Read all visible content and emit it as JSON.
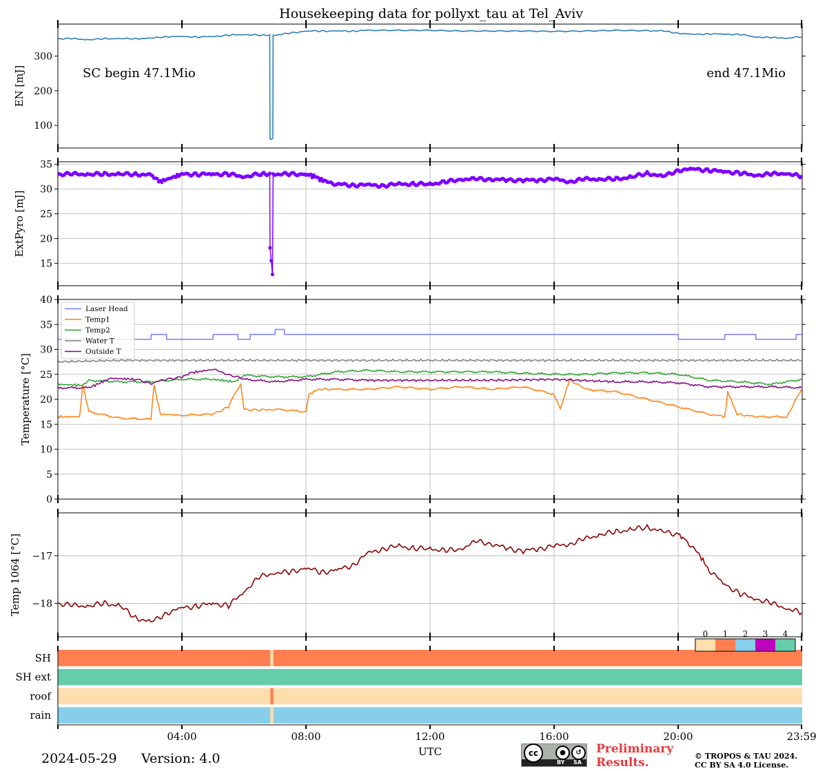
{
  "title": "Housekeeping data for pollyxt_tau at Tel_Aviv",
  "footer": {
    "date": "2024-05-29",
    "version": "Version: 4.0",
    "preliminary": [
      "Preliminary",
      "Results."
    ],
    "copyright": [
      "© TROPOS & TAU 2024.",
      "CC BY SA 4.0 License."
    ],
    "license_badge": {
      "main": "cc",
      "by": "BY",
      "sa": "SA"
    }
  },
  "chart_data": [
    {
      "type": "line",
      "ylabel": "EN [mJ]",
      "xlim": [
        0,
        24
      ],
      "ylim": [
        35,
        392
      ],
      "yticks": [
        100,
        200,
        300
      ],
      "grid": false,
      "annotations": [
        "SC begin 47.1Mio",
        "end 47.1Mio"
      ],
      "series": [
        {
          "color": "#1f77b4",
          "x": [
            0,
            0.5,
            1,
            1.5,
            2,
            2.5,
            3,
            3.5,
            4,
            4.5,
            5,
            5.5,
            6,
            6.5,
            6.83,
            6.84,
            6.85,
            6.93,
            6.94,
            7.0,
            7.5,
            8,
            8.5,
            9,
            9.5,
            10,
            11,
            12,
            13,
            14,
            15,
            16,
            17,
            18,
            19,
            19.5,
            20,
            20.5,
            21,
            21.5,
            22,
            22.5,
            23,
            23.5,
            23.98
          ],
          "y": [
            350,
            350,
            347,
            350,
            350,
            350,
            351,
            356,
            356,
            355,
            356,
            360,
            362,
            360,
            360,
            61,
            61,
            61,
            360,
            360,
            366,
            372,
            372,
            372,
            372,
            374,
            374,
            374,
            372,
            372,
            372,
            371,
            372,
            374,
            373,
            372,
            366,
            362,
            364,
            363,
            362,
            355,
            353,
            352,
            355
          ]
        }
      ]
    },
    {
      "type": "line",
      "ylabel": "ExtPyro [mJ]",
      "xlim": [
        0,
        24
      ],
      "ylim": [
        10.5,
        35.5
      ],
      "yticks": [
        15,
        20,
        25,
        30,
        35
      ],
      "grid": true,
      "series": [
        {
          "color": "#7f00ff",
          "markers": true,
          "x": [
            0,
            0.5,
            1,
            1.5,
            2,
            2.5,
            3,
            3.3,
            4,
            4.5,
            5,
            5.5,
            6,
            6.5,
            6.83,
            6.84,
            6.88,
            6.92,
            6.94,
            7.0,
            7.5,
            8,
            8.3,
            8.6,
            9,
            9.5,
            10,
            10.5,
            11,
            11.5,
            12,
            12.5,
            13,
            13.5,
            14,
            14.5,
            15,
            15.5,
            16,
            16.5,
            17,
            17.5,
            18,
            18.5,
            19,
            19.5,
            20,
            20.5,
            21,
            21.5,
            22,
            22.5,
            23,
            23.5,
            23.98
          ],
          "y": [
            33.0,
            33.0,
            33.0,
            33.0,
            33.0,
            33.0,
            32.8,
            31.5,
            33.0,
            33.0,
            33.0,
            33.0,
            32.5,
            33.0,
            33.0,
            18.0,
            15.5,
            12.5,
            33.0,
            33.0,
            33.0,
            33.0,
            32.5,
            31.5,
            31.0,
            30.8,
            30.8,
            30.7,
            31.0,
            31.0,
            31.0,
            31.4,
            32.0,
            32.0,
            32.0,
            31.8,
            31.8,
            31.8,
            32.0,
            31.5,
            32.0,
            32.0,
            32.0,
            32.4,
            33.2,
            32.5,
            33.8,
            34.0,
            33.8,
            33.5,
            33.2,
            32.8,
            33.0,
            33.2,
            32.5
          ]
        }
      ]
    },
    {
      "type": "line",
      "ylabel": "Temperature [$^\\circ C$]",
      "xlim": [
        0,
        24
      ],
      "ylim": [
        0,
        40
      ],
      "yticks": [
        0,
        5,
        10,
        15,
        20,
        25,
        30,
        35,
        40
      ],
      "grid": true,
      "legend": "top-left",
      "series": [
        {
          "name": "Laser Head",
          "color": "#7a7aff",
          "x": [
            0,
            3,
            3.01,
            3.5,
            3.51,
            5,
            5.01,
            5.8,
            5.81,
            6.2,
            6.21,
            7.0,
            7.01,
            7.3,
            7.31,
            8.0,
            8.01,
            20.0,
            20.01,
            21.5,
            21.51,
            22.5,
            22.51,
            23.8,
            23.81,
            23.98
          ],
          "y": [
            32,
            32,
            33,
            33,
            32,
            32,
            33,
            33,
            32,
            32,
            33,
            33,
            34,
            34,
            33,
            33,
            33,
            33,
            32,
            32,
            33,
            33,
            32,
            32,
            33,
            33
          ]
        },
        {
          "name": "Temp1",
          "color": "#ff7f0e",
          "x": [
            0,
            0.7,
            0.8,
            1.0,
            2.0,
            3.0,
            3.1,
            3.3,
            4.0,
            5.0,
            5.5,
            5.6,
            5.9,
            6.0,
            6.5,
            7.0,
            8.0,
            8.1,
            8.4,
            9.0,
            10.0,
            11.0,
            12.0,
            13.0,
            14.0,
            15.0,
            16.0,
            16.2,
            16.5,
            17.0,
            18.0,
            19.0,
            20.0,
            21.0,
            21.5,
            21.6,
            21.9,
            22.5,
            23.5,
            23.98
          ],
          "y": [
            16.5,
            16.5,
            23.0,
            17.5,
            16.2,
            16.0,
            23.0,
            17.0,
            16.8,
            17.0,
            18.5,
            20.0,
            23.0,
            18.0,
            17.8,
            18.0,
            17.5,
            21.0,
            22.0,
            22.0,
            22.0,
            22.5,
            22.0,
            22.5,
            22.0,
            22.5,
            21.0,
            18.0,
            24.0,
            22.0,
            21.5,
            20.0,
            18.5,
            17.0,
            16.5,
            21.5,
            17.0,
            16.5,
            16.5,
            22.0
          ]
        },
        {
          "name": "Temp2",
          "color": "#2ca02c",
          "x": [
            0,
            0.8,
            1.0,
            2.0,
            3.0,
            4.0,
            5.0,
            5.7,
            6.0,
            7.0,
            8.0,
            9.0,
            10.0,
            11.0,
            12.0,
            13.0,
            14.0,
            15.0,
            16.0,
            17.0,
            18.0,
            19.0,
            20.0,
            21.0,
            22.0,
            23.0,
            23.98
          ],
          "y": [
            23.0,
            22.8,
            23.8,
            23.5,
            23.5,
            24.0,
            24.0,
            23.5,
            24.8,
            24.5,
            24.5,
            25.5,
            25.8,
            25.5,
            25.5,
            25.5,
            25.5,
            25.2,
            25.0,
            25.0,
            25.3,
            25.3,
            25.0,
            23.8,
            23.5,
            23.0,
            24.0
          ]
        },
        {
          "name": "Water T",
          "color": "#7f7f7f",
          "x": [
            0,
            2,
            4,
            6,
            8,
            10,
            12,
            14,
            16,
            18,
            20,
            22,
            23.98
          ],
          "y": [
            27.5,
            27.8,
            27.8,
            27.8,
            27.8,
            27.8,
            27.8,
            27.8,
            27.8,
            27.8,
            27.8,
            27.8,
            27.8
          ]
        },
        {
          "name": "Outside T",
          "color": "#800080",
          "x": [
            0,
            1.0,
            1.7,
            2.5,
            3.0,
            3.5,
            4.0,
            4.3,
            5.0,
            5.5,
            6.0,
            7.0,
            8.0,
            9.0,
            10.0,
            12.0,
            14.0,
            16.0,
            18.0,
            19.0,
            20.0,
            21.0,
            22.0,
            23.0,
            23.98
          ],
          "y": [
            22.3,
            22.3,
            24.2,
            24.0,
            23.2,
            24.0,
            24.5,
            25.3,
            26.0,
            25.0,
            24.0,
            23.5,
            24.0,
            24.0,
            23.8,
            23.8,
            23.8,
            24.0,
            23.5,
            23.5,
            23.3,
            22.5,
            22.5,
            22.5,
            22.3
          ]
        }
      ]
    },
    {
      "type": "line",
      "ylabel": "Temp 1064 [$^\\circ C$]",
      "xlim": [
        0,
        24
      ],
      "ylim": [
        -18.7,
        -16.1
      ],
      "yticks": [
        -18,
        -17
      ],
      "grid": true,
      "series": [
        {
          "color": "#8b0000",
          "x": [
            0,
            0.5,
            1,
            1.5,
            2,
            2.5,
            3,
            3.5,
            4,
            4.5,
            5,
            5.5,
            6,
            6.5,
            7,
            7.5,
            8,
            8.5,
            9,
            9.5,
            10,
            10.5,
            11,
            11.5,
            12,
            12.5,
            13,
            13.5,
            14,
            14.5,
            15,
            15.5,
            16,
            16.5,
            17,
            17.5,
            18,
            18.5,
            19,
            19.5,
            20,
            20.3,
            20.7,
            21,
            21.5,
            22,
            22.5,
            23,
            23.5,
            23.98
          ],
          "y": [
            -18.0,
            -18.05,
            -18.05,
            -18.0,
            -18.05,
            -18.3,
            -18.4,
            -18.2,
            -18.1,
            -18.05,
            -18.0,
            -18.05,
            -17.75,
            -17.45,
            -17.35,
            -17.35,
            -17.25,
            -17.35,
            -17.3,
            -17.2,
            -16.95,
            -16.85,
            -16.8,
            -16.85,
            -16.85,
            -16.9,
            -16.85,
            -16.7,
            -16.75,
            -16.85,
            -16.9,
            -16.85,
            -16.8,
            -16.75,
            -16.65,
            -16.55,
            -16.5,
            -16.45,
            -16.4,
            -16.5,
            -16.55,
            -16.7,
            -17.0,
            -17.3,
            -17.6,
            -17.8,
            -17.9,
            -18.0,
            -18.1,
            -18.2
          ]
        }
      ]
    },
    {
      "type": "heatmap",
      "categories": [
        "SH",
        "SH ext",
        "roof",
        "rain"
      ],
      "xlabel": "UTC",
      "xlim": [
        0,
        24
      ],
      "xticklabels": [
        "04:00",
        "08:00",
        "12:00",
        "16:00",
        "20:00",
        "23:59"
      ],
      "xticks": [
        4,
        8,
        12,
        16,
        20,
        23.98
      ],
      "colorbar": {
        "labels": [
          "0",
          "1",
          "2",
          "3",
          "4"
        ],
        "colors": [
          "#ffdead",
          "#ff7f50",
          "#87ceeb",
          "#c000c0",
          "#66cdaa"
        ]
      },
      "rows": [
        {
          "base": 1,
          "segments": [
            {
              "start": 6.85,
              "end": 6.95,
              "value": 0
            }
          ]
        },
        {
          "base": 4,
          "segments": []
        },
        {
          "base": 0,
          "segments": [
            {
              "start": 6.85,
              "end": 6.95,
              "value": 1
            }
          ]
        },
        {
          "base": 2,
          "segments": [
            {
              "start": 6.85,
              "end": 6.95,
              "value": 0
            }
          ]
        }
      ]
    }
  ]
}
